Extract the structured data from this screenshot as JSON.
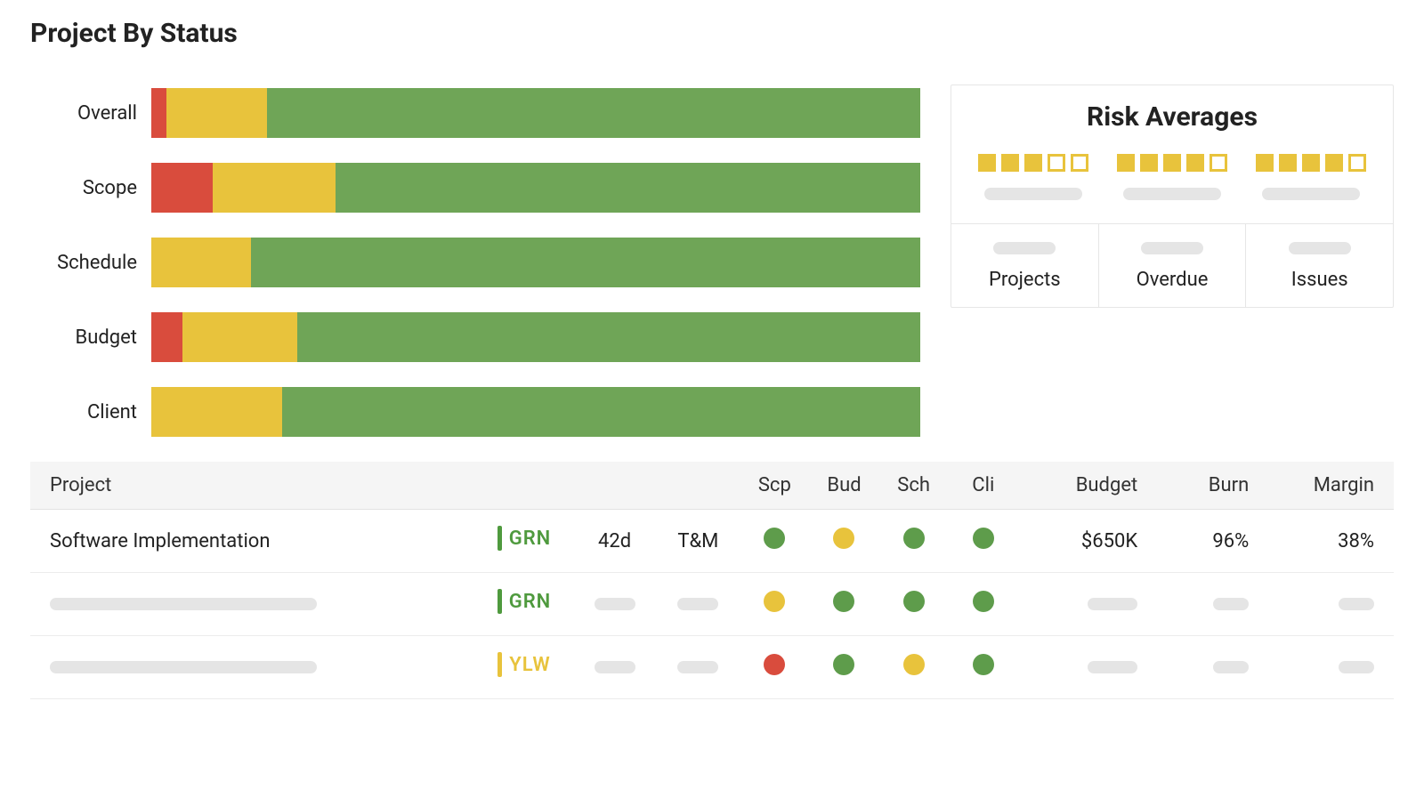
{
  "title": "Project By Status",
  "colors": {
    "red": "#d94c3d",
    "yellow": "#e8c33c",
    "green": "#6fa557"
  },
  "chart_data": {
    "type": "bar",
    "title": "Project By Status",
    "stack": "100",
    "xlabel": "",
    "ylabel": "",
    "categories": [
      "Overall",
      "Scope",
      "Schedule",
      "Budget",
      "Client"
    ],
    "series": [
      {
        "name": "Red",
        "color": "#d94c3d",
        "values": [
          2,
          8,
          0,
          4,
          0
        ]
      },
      {
        "name": "Yellow",
        "color": "#e8c33c",
        "values": [
          13,
          16,
          13,
          15,
          17
        ]
      },
      {
        "name": "Green",
        "color": "#6fa557",
        "values": [
          85,
          76,
          87,
          81,
          83
        ]
      }
    ],
    "ylim": [
      0,
      100
    ]
  },
  "risk": {
    "title": "Risk Averages",
    "groups": [
      {
        "filled": 3,
        "total": 5
      },
      {
        "filled": 4,
        "total": 5
      },
      {
        "filled": 4,
        "total": 5
      }
    ],
    "summary": [
      {
        "label": "Projects"
      },
      {
        "label": "Overdue"
      },
      {
        "label": "Issues"
      }
    ]
  },
  "table": {
    "cols": {
      "project": "Project",
      "scp": "Scp",
      "bud": "Bud",
      "sch": "Sch",
      "cli": "Cli",
      "budget": "Budget",
      "burn": "Burn",
      "margin": "Margin"
    },
    "rows": [
      {
        "name": "Software Implementation",
        "status": {
          "code": "GRN",
          "class": "green"
        },
        "age": "42d",
        "type": "T&M",
        "dots": {
          "scp": "green",
          "bud": "yellow",
          "sch": "green",
          "cli": "green"
        },
        "budget": "$650K",
        "burn": "96%",
        "margin": "38%"
      },
      {
        "name": null,
        "status": {
          "code": "GRN",
          "class": "green"
        },
        "age": null,
        "type": null,
        "dots": {
          "scp": "yellow",
          "bud": "green",
          "sch": "green",
          "cli": "green"
        },
        "budget": null,
        "burn": null,
        "margin": null
      },
      {
        "name": null,
        "status": {
          "code": "YLW",
          "class": "yellow"
        },
        "age": null,
        "type": null,
        "dots": {
          "scp": "red",
          "bud": "green",
          "sch": "yellow",
          "cli": "green"
        },
        "budget": null,
        "burn": null,
        "margin": null
      }
    ]
  }
}
